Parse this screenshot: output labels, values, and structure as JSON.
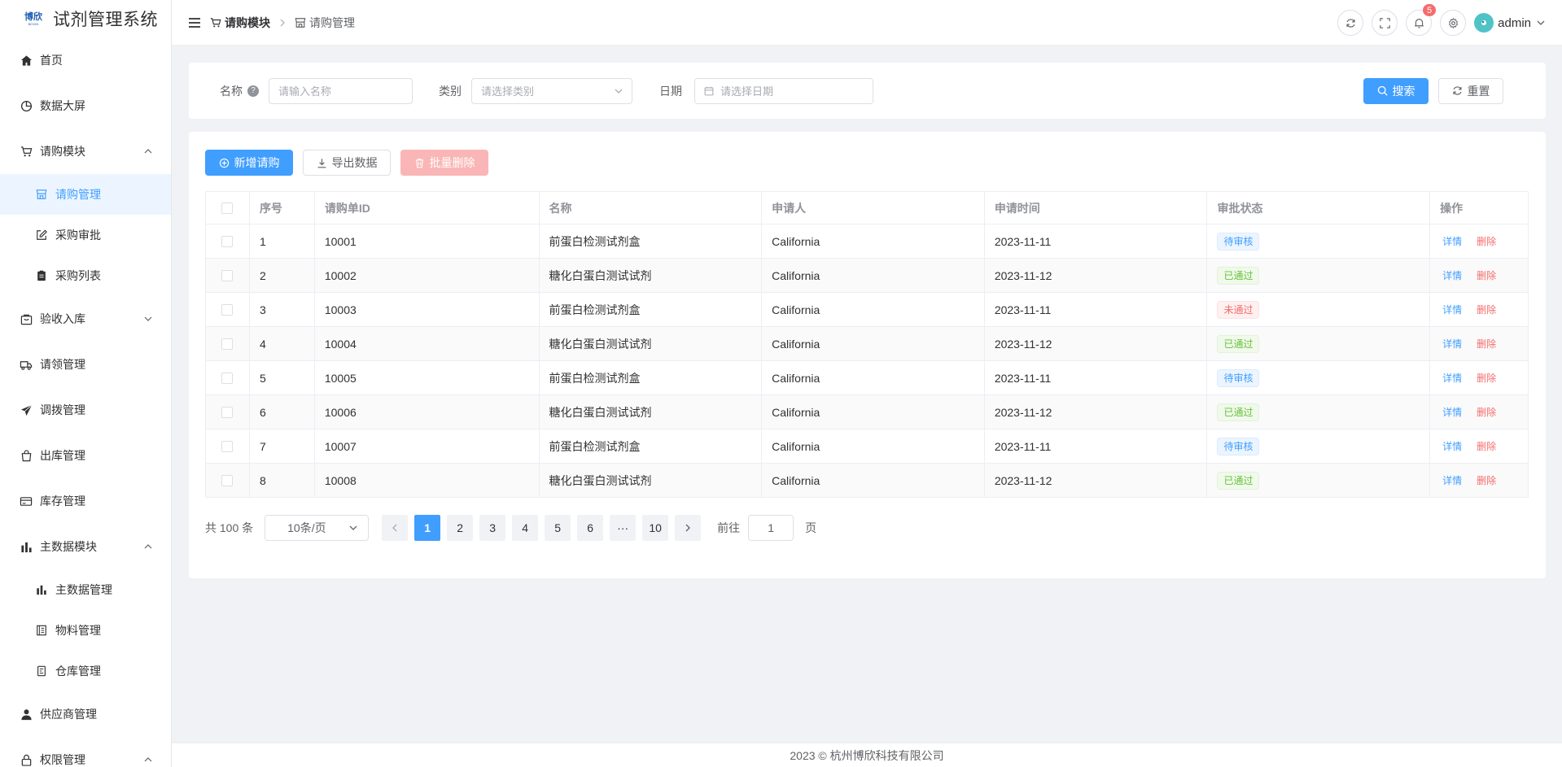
{
  "app": {
    "logo_text": "博欣",
    "logo_sub": "BOXIN",
    "title": "试剂管理系统"
  },
  "sidebar": {
    "items": [
      {
        "label": "首页",
        "icon": "home-icon"
      },
      {
        "label": "数据大屏",
        "icon": "pie-chart-icon"
      },
      {
        "label": "请购模块",
        "icon": "shopping-cart-icon",
        "expanded": true,
        "children": [
          {
            "label": "请购管理",
            "icon": "shop-icon",
            "active": true
          },
          {
            "label": "采购审批",
            "icon": "edit-icon"
          },
          {
            "label": "采购列表",
            "icon": "clipboard-icon"
          }
        ]
      },
      {
        "label": "验收入库",
        "icon": "box-icon",
        "expanded": false
      },
      {
        "label": "请领管理",
        "icon": "truck-icon"
      },
      {
        "label": "调拨管理",
        "icon": "send-icon"
      },
      {
        "label": "出库管理",
        "icon": "bag-icon"
      },
      {
        "label": "库存管理",
        "icon": "card-icon"
      },
      {
        "label": "主数据模块",
        "icon": "bar-chart-icon",
        "expanded": true,
        "children": [
          {
            "label": "主数据管理",
            "icon": "bar-chart-icon"
          },
          {
            "label": "物料管理",
            "icon": "notebook-icon"
          },
          {
            "label": "仓库管理",
            "icon": "document-icon"
          }
        ]
      },
      {
        "label": "供应商管理",
        "icon": "user-icon"
      },
      {
        "label": "权限管理",
        "icon": "lock-icon",
        "expanded": true
      }
    ]
  },
  "header": {
    "breadcrumb": [
      "请购模块",
      "请购管理"
    ],
    "notification_count": "5",
    "user_name": "admin"
  },
  "search": {
    "name_label": "名称",
    "name_placeholder": "请输入名称",
    "category_label": "类别",
    "category_placeholder": "请选择类别",
    "date_label": "日期",
    "date_placeholder": "请选择日期",
    "search_button": "搜索",
    "reset_button": "重置"
  },
  "toolbar": {
    "add_button": "新增请购",
    "export_button": "导出数据",
    "batch_delete_button": "批量删除"
  },
  "table": {
    "columns": [
      "序号",
      "请购单ID",
      "名称",
      "申请人",
      "申请时间",
      "审批状态",
      "操作"
    ],
    "rows": [
      {
        "idx": "1",
        "id": "10001",
        "name": "前蛋白检测试剂盒",
        "applicant": "California",
        "date": "2023-11-11",
        "status": "待审核",
        "status_type": "pending"
      },
      {
        "idx": "2",
        "id": "10002",
        "name": "糖化白蛋白测试试剂",
        "applicant": "California",
        "date": "2023-11-12",
        "status": "已通过",
        "status_type": "pass"
      },
      {
        "idx": "3",
        "id": "10003",
        "name": "前蛋白检测试剂盒",
        "applicant": "California",
        "date": "2023-11-11",
        "status": "未通过",
        "status_type": "fail"
      },
      {
        "idx": "4",
        "id": "10004",
        "name": "糖化白蛋白测试试剂",
        "applicant": "California",
        "date": "2023-11-12",
        "status": "已通过",
        "status_type": "pass"
      },
      {
        "idx": "5",
        "id": "10005",
        "name": "前蛋白检测试剂盒",
        "applicant": "California",
        "date": "2023-11-11",
        "status": "待审核",
        "status_type": "pending"
      },
      {
        "idx": "6",
        "id": "10006",
        "name": "糖化白蛋白测试试剂",
        "applicant": "California",
        "date": "2023-11-12",
        "status": "已通过",
        "status_type": "pass"
      },
      {
        "idx": "7",
        "id": "10007",
        "name": "前蛋白检测试剂盒",
        "applicant": "California",
        "date": "2023-11-11",
        "status": "待审核",
        "status_type": "pending"
      },
      {
        "idx": "8",
        "id": "10008",
        "name": "糖化白蛋白测试试剂",
        "applicant": "California",
        "date": "2023-11-12",
        "status": "已通过",
        "status_type": "pass"
      }
    ],
    "action_detail": "详情",
    "action_delete": "删除"
  },
  "pagination": {
    "total_text": "共 100 条",
    "page_size": "10条/页",
    "pages": [
      "1",
      "2",
      "3",
      "4",
      "5",
      "6",
      "···",
      "10"
    ],
    "current": "1",
    "jump_prefix": "前往",
    "jump_value": "1",
    "jump_suffix": "页"
  },
  "footer": {
    "text": "2023 © 杭州博欣科技有限公司"
  },
  "colors": {
    "primary": "#409eff",
    "success": "#67c23a",
    "danger": "#f56c6c",
    "active_bg": "#ecf5ff"
  }
}
